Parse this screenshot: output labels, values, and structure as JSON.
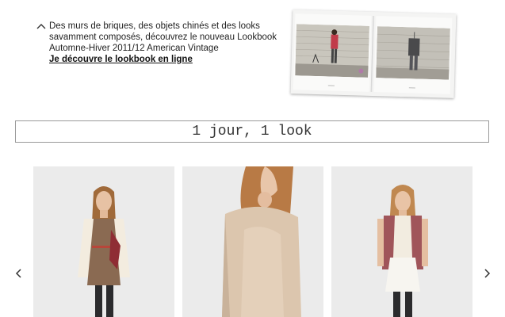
{
  "promo": {
    "text": "Des murs de briques, des objets chinés et des looks savamment composés, découvrez le nouveau Lookbook Automne-Hiver 2011/12 American Vintage",
    "link": "Je découvre le lookbook en ligne",
    "icon": "chevron-up-icon"
  },
  "section_title": "1 jour, 1 look",
  "carousel": {
    "prev_icon": "chevron-left-icon",
    "next_icon": "chevron-right-icon",
    "looks": [
      {
        "name": "look-1"
      },
      {
        "name": "look-2"
      },
      {
        "name": "look-3"
      }
    ]
  },
  "colors": {
    "text": "#222222",
    "border": "#9a9a9a",
    "photo_bg": "#ececec"
  }
}
